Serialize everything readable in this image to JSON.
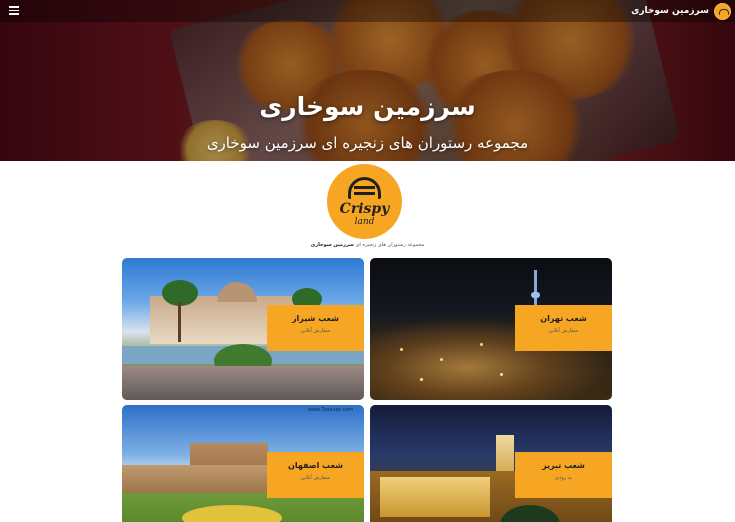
{
  "topbar": {
    "brand_name": "سرزمین سوخاری",
    "menu_icon": "hamburger-icon",
    "brand_icon": "crispy-land-logo"
  },
  "hero": {
    "title": "سرزمین سوخاری",
    "subtitle": "مجموعه رستوران های زنجیره ای سرزمین سوخاری"
  },
  "logo": {
    "word1": "Crispy",
    "word2": "land"
  },
  "tagline": {
    "prefix": "مجموعه رستوران های زنجیره ای ",
    "brand": "سرزمین سوخاری"
  },
  "colors": {
    "accent": "#f6a623",
    "hero_dark": "#6b1420"
  },
  "branches": [
    {
      "title": "شعب تهران",
      "status": "سفارش آنلاین"
    },
    {
      "title": "شعب شیراز",
      "status": "سفارش آنلاین"
    },
    {
      "title": "شعب تبریز",
      "status": "به زودی"
    },
    {
      "title": "شعب اصفهان",
      "status": "سفارش آنلاین"
    }
  ],
  "watermark": "www.Tasavaz.com"
}
